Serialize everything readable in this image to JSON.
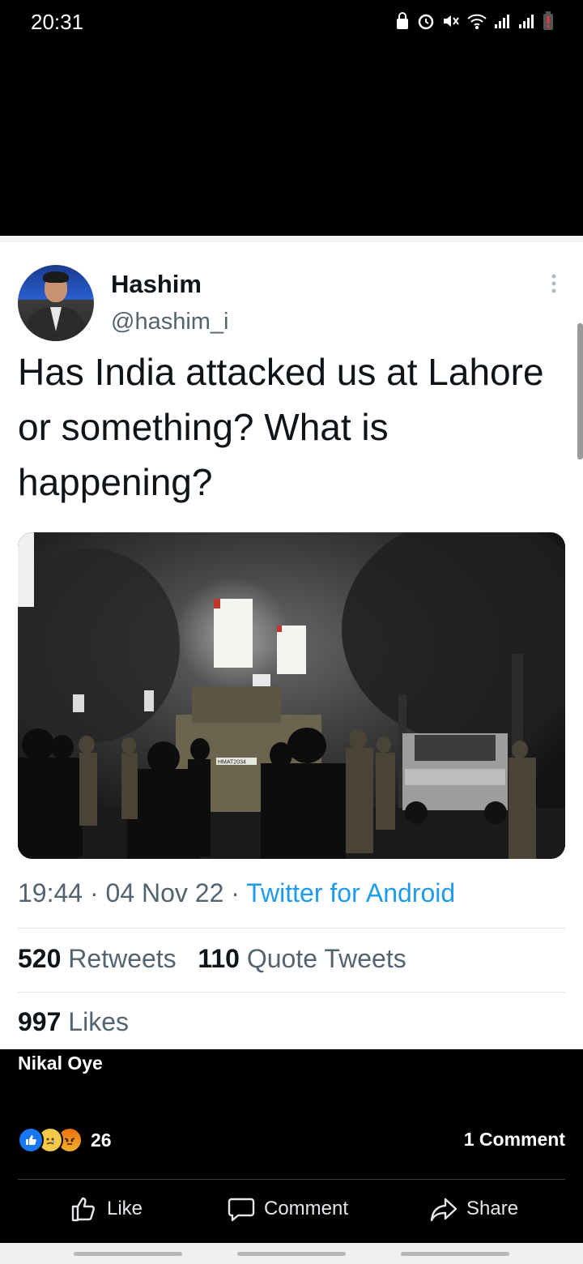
{
  "status_bar": {
    "time": "20:31",
    "icons": [
      "lock-icon",
      "alarm-icon",
      "mute-icon",
      "wifi-icon",
      "signal-icon",
      "signal-icon",
      "battery-low-icon"
    ]
  },
  "tweet": {
    "display_name": "Hashim",
    "handle": "@hashim_i",
    "text": "Has India attacked us at Lahore or something? What is happening?",
    "time": "19:44",
    "date": "04 Nov 22",
    "source": "Twitter for Android",
    "sep": " · ",
    "retweets_count": "520",
    "retweets_label": "Retweets",
    "quotes_count": "110",
    "quotes_label": "Quote Tweets",
    "likes_count": "997",
    "likes_label": "Likes",
    "photo_vehicle_label": "HMAT2034"
  },
  "post": {
    "caption": "Nikal Oye",
    "reaction_count": "26",
    "comment_count": "1 Comment",
    "reactions": [
      "like-icon",
      "sad-icon",
      "angry-icon"
    ],
    "actions": {
      "like": "Like",
      "comment": "Comment",
      "share": "Share"
    }
  },
  "colors": {
    "twitter_blue": "#1d9bf0",
    "facebook_blue": "#1877f2"
  }
}
